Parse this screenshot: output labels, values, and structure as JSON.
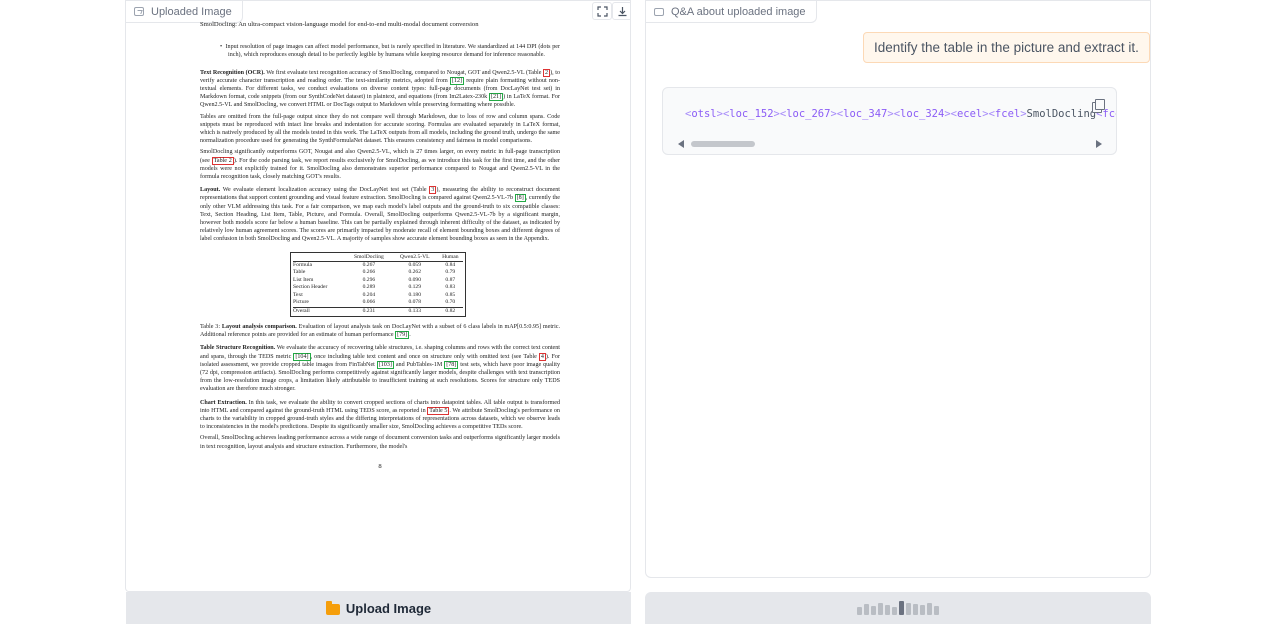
{
  "left_panel": {
    "tab_label": "Uploaded Image",
    "fullscreen_icon": "fullscreen-icon",
    "download_icon": "download-icon"
  },
  "document": {
    "running_head": "SmolDocling: An ultra-compact vision-language model for end-to-end multi-modal document conversion",
    "bullet": "Input resolution of page images can affect model performance, but is rarely specified in literature. We standardized at 144 DPI (dots per inch), which reproduces enough detail to be perfectly legible by humans while keeping resource demand for inference reasonable.",
    "p_ocr_title": "Text Recognition (OCR).",
    "p_ocr_1": "We first evaluate text recognition accuracy of SmolDocling, compared to Nougat, GOT and Qwen2.5-VL (Table",
    "p_ocr_ref1": "2",
    "p_ocr_2": "), to verify accurate character transcription and reading order. The text-similarity metrics, adopted from",
    "p_ocr_ref2": "[12]",
    "p_ocr_3": "require plain formatting without non-textual elements. For different tasks, we conduct evaluations on diverse content types: full-page documents (from DocLayNet test set) in Markdown format, code snippets (from our SynthCodeNet dataset) in plaintext, and equations (from Im2Latex-230k",
    "p_ocr_ref3": "[21]",
    "p_ocr_4": ") in LaTeX format. For Qwen2.5-VL and SmolDocling, we convert HTML or DocTags output to Markdown while preserving formatting where possible.",
    "p_tables": "Tables are omitted from the full-page output since they do not compare well through Markdown, due to loss of row and column spans. Code snippets must be reproduced with intact line breaks and indentation for accurate scoring. Formulas are evaluated separately in LaTeX format, which is natively produced by all the models tested in this work. The LaTeX outputs from all models, including the ground truth, undergo the same normalization procedure used for generating the SynthFormulaNet dataset. This ensures consistency and fairness in model comparisons.",
    "p_outperf_1": "SmolDocling significantly outperforms GOT, Nougat and also Qwen2.5-VL, which is 27 times larger, on every metric in full-page transcription (see",
    "p_outperf_ref": "Table 2",
    "p_outperf_2": "). For the code parsing task, we report results exclusively for SmolDocling, as we introduce this task for the first time, and the other models were not explicitly trained for it. SmolDocling also demonstrates superior performance compared to Nougat and Qwen2.5-VL in the formula recognition task, closely matching GOT's results.",
    "p_layout_title": "Layout.",
    "p_layout_1": "We evaluate element localization accuracy using the DocLayNet test set (Table",
    "p_layout_ref1": "3",
    "p_layout_2": "), measuring the ability to reconstruct document representations that support content grounding and visual feature extraction. SmolDocling is compared against Qwen2.5-VL-7b",
    "p_layout_ref2": "[8]",
    "p_layout_3": ", currently the only other VLM addressing this task. For a fair comparison, we map each model's label outputs and the ground-truth to six compatible classes: Text, Section Heading, List Item, Table, Picture, and Formula. Overall, SmolDocling outperforms Qwen2.5-VL-7b by a significant margin, however both models score far below a human baseline. This can be partially explained through inherent difficulty of the dataset, as indicated by relatively low human agreement scores. The scores are primarily impacted by moderate recall of element bounding boxes and different degrees of label confusion in both SmolDocling and Qwen2.5-VL. A majority of samples show accurate element bounding boxes as seen in the Appendix.",
    "table3": {
      "headers": [
        "",
        "SmolDocling",
        "Qwen2.5-VL",
        "Human"
      ],
      "rows": [
        [
          "Formula",
          "0.267",
          "0.059",
          "0.84"
        ],
        [
          "Table",
          "0.266",
          "0.262",
          "0.79"
        ],
        [
          "List Item",
          "0.296",
          "0.090",
          "0.87"
        ],
        [
          "Section Header",
          "0.289",
          "0.129",
          "0.83"
        ],
        [
          "Text",
          "0.204",
          "0.180",
          "0.85"
        ],
        [
          "Picture",
          "0.066",
          "0.078",
          "0.70"
        ]
      ],
      "overall": [
        "Overall",
        "0.231",
        "0.133",
        "0.82"
      ]
    },
    "caption_label": "Table 3:",
    "caption_title": "Layout analysis comparison.",
    "caption_text": "Evaluation of layout analysis task on DocLayNet with a subset of 6 class labels in mAP[0.5:0.95] metric. Additional reference points are provided for an estimate of human performance",
    "caption_ref": "[79]",
    "p_tsr_title": "Table Structure Recognition.",
    "p_tsr_1": "We evaluate the accuracy of recovering table structures, i.e. shaping columns and rows with the correct text content and spans, through the TEDS metric",
    "p_tsr_ref1": "[104]",
    "p_tsr_2": ", once including table text content and once on structure only with omitted text (see Table",
    "p_tsr_ref2": "4",
    "p_tsr_3": "). For isolated assessment, we provide cropped table images from FinTabNet",
    "p_tsr_ref3": "[103]",
    "p_tsr_4": "and PubTables-1M",
    "p_tsr_ref4": "[78]",
    "p_tsr_5": "test sets, which have poor image quality (72 dpi, compression artifacts). SmolDocling performs competitively against significantly larger models, despite challenges with text transcription from the low-resolution image crops, a limitation likely attributable to insufficient training at such resolutions. Scores for structure only TEDS evaluation are therefore much stronger.",
    "p_chart_title": "Chart Extraction.",
    "p_chart_1": "In this task, we evaluate the ability to convert cropped sections of charts into datapoint tables. All table output is transformed into HTML and compared against the ground-truth HTML using TEDS score, as reported in",
    "p_chart_ref": "Table 5",
    "p_chart_2": ". We attribute SmolDocling's performance on charts to the variability in cropped ground-truth styles and the differing interpretations of representations across datasets, which we observe leads to inconsistencies in the model's predictions. Despite its significantly smaller size, SmolDocling achieves a competitive TEDs score.",
    "p_overall": "Overall, SmolDocling achieves leading performance across a wide range of document conversion tasks and outperforms significantly larger models in text recognition, layout analysis and structure extraction. Furthermore, the model's",
    "page_num": "8"
  },
  "upload_button": {
    "label": "Upload Image",
    "icon": "folder-icon"
  },
  "right_panel": {
    "tab_label": "Q&A about uploaded image",
    "user_message": "Identify the table in the picture and extract it.",
    "bot_code": {
      "tags": [
        "otsl",
        "loc_152",
        "loc_267",
        "loc_347",
        "loc_324",
        "ecel",
        "fcel"
      ],
      "text": "SmolDocling",
      "trailing_tag": "fcel"
    }
  },
  "submit_button": {
    "state": "loading"
  },
  "colors": {
    "accent_orange_bg": "#fff7ed",
    "tag_purple": "#8b5cf6",
    "ref_green": "#22aa44",
    "ref_red": "#dd3333"
  }
}
